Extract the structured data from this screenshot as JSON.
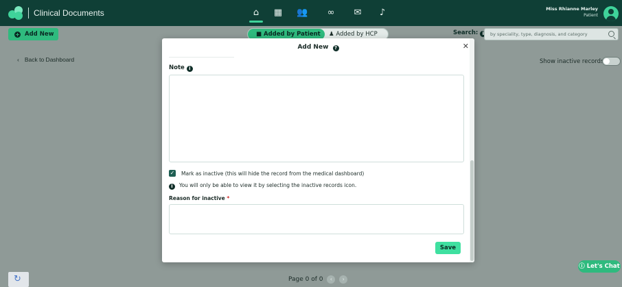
{
  "app": {
    "title": "Clinical Documents"
  },
  "nav": {
    "icons": [
      "home-icon",
      "calendar-icon",
      "people-icon",
      "link-icon",
      "mail-icon",
      "bell-icon"
    ]
  },
  "user": {
    "name": "Miss Rhianne Marley",
    "role": "Patient"
  },
  "toolbar": {
    "add_new_label": "Add New",
    "tab_patient": "Added by Patient",
    "tab_hcp": "Added by HCP",
    "search_label": "Search:",
    "search_placeholder": "by speciality, type, diagnosis, and category"
  },
  "page": {
    "back_label": "Back to Dashboard",
    "show_inactive_label": "Show inactive records",
    "pagination": "Page 0 of 0",
    "chat_label": "Let's Chat"
  },
  "modal": {
    "title": "Add New",
    "note_label": "Note",
    "note_value": "",
    "inactive_checkbox_label": "Mark as inactive (this will hide the record from the medical dashboard)",
    "inactive_checked": true,
    "info_message": "You will only be able to view it by selecting the inactive records icon.",
    "reason_label": "Reason for inactive",
    "required_marker": "*",
    "reason_value": "",
    "save_label": "Save"
  },
  "colors": {
    "header": "#0f3f36",
    "accent": "#2fba7e",
    "save_button": "#3fe0a0",
    "overlay": "#8f9a97"
  }
}
